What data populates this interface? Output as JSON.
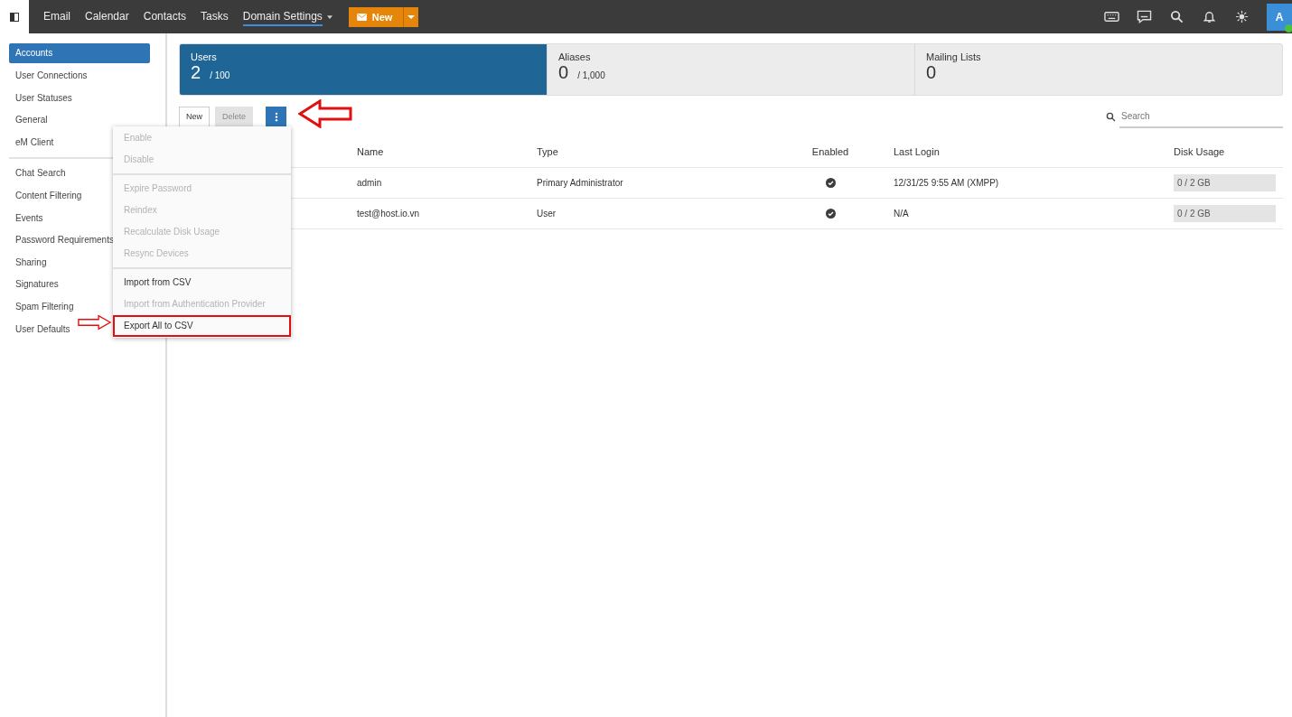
{
  "topbar": {
    "nav": [
      {
        "label": "Email",
        "selected": false
      },
      {
        "label": "Calendar",
        "selected": false
      },
      {
        "label": "Contacts",
        "selected": false
      },
      {
        "label": "Tasks",
        "selected": false
      },
      {
        "label": "Domain Settings",
        "selected": true
      }
    ],
    "new_button": "New",
    "avatar": "A"
  },
  "sidebar": {
    "groups": [
      [
        {
          "label": "Accounts",
          "selected": true
        },
        {
          "label": "User Connections",
          "selected": false
        },
        {
          "label": "User Statuses",
          "selected": false
        },
        {
          "label": "General",
          "selected": false
        },
        {
          "label": "eM Client",
          "selected": false
        }
      ],
      [
        {
          "label": "Chat Search",
          "selected": false
        },
        {
          "label": "Content Filtering",
          "selected": false
        },
        {
          "label": "Events",
          "selected": false
        },
        {
          "label": "Password Requirements",
          "selected": false
        },
        {
          "label": "Sharing",
          "selected": false
        },
        {
          "label": "Signatures",
          "selected": false
        },
        {
          "label": "Spam Filtering",
          "selected": false
        },
        {
          "label": "User Defaults",
          "selected": false
        }
      ]
    ]
  },
  "stats": [
    {
      "label": "Users",
      "count": "2",
      "limit": "/ 100",
      "selected": true
    },
    {
      "label": "Aliases",
      "count": "0",
      "limit": "/ 1,000",
      "selected": false
    },
    {
      "label": "Mailing Lists",
      "count": "0",
      "selected": false
    }
  ],
  "toolbar": {
    "buttons": [
      {
        "label": "New",
        "disabled": false
      },
      {
        "label": "Delete",
        "disabled": true
      }
    ],
    "search": {
      "placeholder": "Search"
    }
  },
  "menu": {
    "groups": [
      [
        {
          "label": "Enable",
          "disabled": true,
          "highlighted": false
        },
        {
          "label": "Disable",
          "disabled": true,
          "highlighted": false
        }
      ],
      [
        {
          "label": "Expire Password",
          "disabled": true,
          "highlighted": false
        },
        {
          "label": "Reindex",
          "disabled": true,
          "highlighted": false
        },
        {
          "label": "Recalculate Disk Usage",
          "disabled": true,
          "highlighted": false
        },
        {
          "label": "Resync Devices",
          "disabled": true,
          "highlighted": false
        }
      ],
      [
        {
          "label": "Import from CSV",
          "disabled": false,
          "highlighted": false
        },
        {
          "label": "Import from Authentication Provider",
          "disabled": true,
          "highlighted": false
        },
        {
          "label": "Export All to CSV",
          "disabled": false,
          "highlighted": true
        }
      ]
    ]
  },
  "table": {
    "columns": [
      "Name",
      "Type",
      "Enabled",
      "Last Login",
      "Disk Usage"
    ],
    "rows": [
      {
        "name": "admin",
        "type": "Primary Administrator",
        "enabled": true,
        "last_login": "12/31/25 9:55 AM (XMPP)",
        "disk_usage": "0 / 2 GB"
      },
      {
        "name": "test@host.io.vn",
        "type": "User",
        "enabled": true,
        "last_login": "N/A",
        "disk_usage": "0 / 2 GB"
      }
    ]
  }
}
